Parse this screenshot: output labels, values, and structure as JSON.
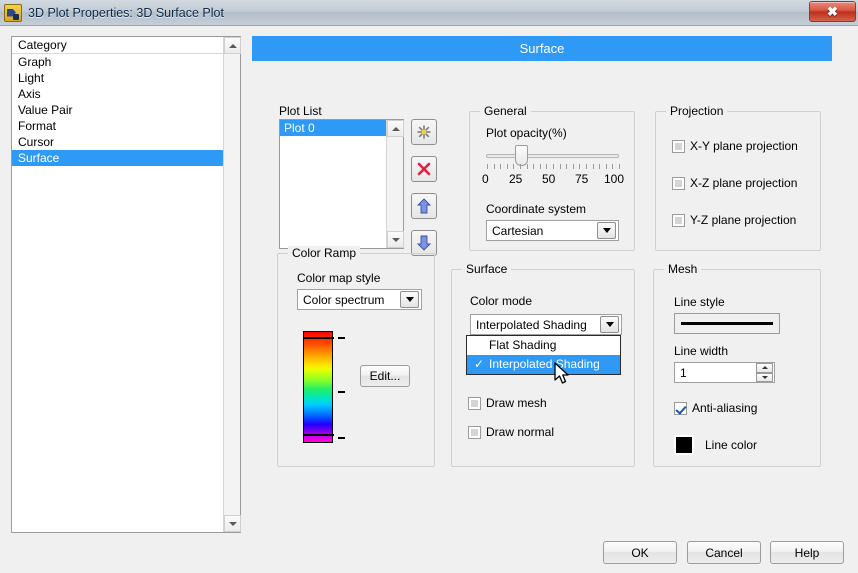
{
  "window": {
    "title": "3D Plot Properties: 3D Surface Plot",
    "icon": "labview-plot-icon",
    "close_label": "✖"
  },
  "banner": {
    "title": "Surface",
    "color": "#2e9af6"
  },
  "category_panel": {
    "header": "Category",
    "items": [
      {
        "label": "Graph",
        "selected": false
      },
      {
        "label": "Light",
        "selected": false
      },
      {
        "label": "Axis",
        "selected": false
      },
      {
        "label": "Value Pair",
        "selected": false
      },
      {
        "label": "Format",
        "selected": false
      },
      {
        "label": "Cursor",
        "selected": false
      },
      {
        "label": "Surface",
        "selected": true
      }
    ]
  },
  "plot_list": {
    "title": "Plot List",
    "items": [
      {
        "label": "Plot 0",
        "selected": true
      }
    ],
    "buttons": [
      {
        "name": "add-plot-button",
        "icon": "asterisk-icon"
      },
      {
        "name": "delete-plot-button",
        "icon": "red-x-icon"
      },
      {
        "name": "move-up-button",
        "icon": "arrow-up-icon"
      },
      {
        "name": "move-down-button",
        "icon": "arrow-down-icon"
      }
    ]
  },
  "general": {
    "legend": "General",
    "opacity_label": "Plot opacity(%)",
    "opacity_value": 27,
    "opacity_ticks": [
      "0",
      "25",
      "50",
      "75",
      "100"
    ],
    "coordinate_label": "Coordinate system",
    "coordinate_value": "Cartesian"
  },
  "projection": {
    "legend": "Projection",
    "checkboxes": [
      {
        "label": "X-Y plane projection",
        "checked": false
      },
      {
        "label": "X-Z plane projection",
        "checked": false
      },
      {
        "label": "Y-Z plane projection",
        "checked": false
      }
    ]
  },
  "color_ramp": {
    "legend": "Color Ramp",
    "style_label": "Color map style",
    "style_value": "Color spectrum",
    "edit_label": "Edit..."
  },
  "surface": {
    "legend": "Surface",
    "color_mode_label": "Color mode",
    "color_mode_value": "Interpolated Shading",
    "dropdown_open": true,
    "dropdown_options": [
      {
        "label": "Flat Shading",
        "checked": false,
        "highlighted": false
      },
      {
        "label": "Interpolated Shading",
        "checked": true,
        "highlighted": true
      }
    ],
    "check_glyph": "✓",
    "checkboxes": [
      {
        "label": "Draw mesh",
        "checked": false
      },
      {
        "label": "Draw normal",
        "checked": false
      }
    ]
  },
  "mesh": {
    "legend": "Mesh",
    "line_style_label": "Line style",
    "line_style_value": "solid",
    "line_width_label": "Line width",
    "line_width_value": "1",
    "antialias_label": "Anti-aliasing",
    "antialias_checked": true,
    "line_color_label": "Line color",
    "line_color_value": "#000000"
  },
  "footer": {
    "ok_label": "OK",
    "cancel_label": "Cancel",
    "help_label": "Help"
  }
}
